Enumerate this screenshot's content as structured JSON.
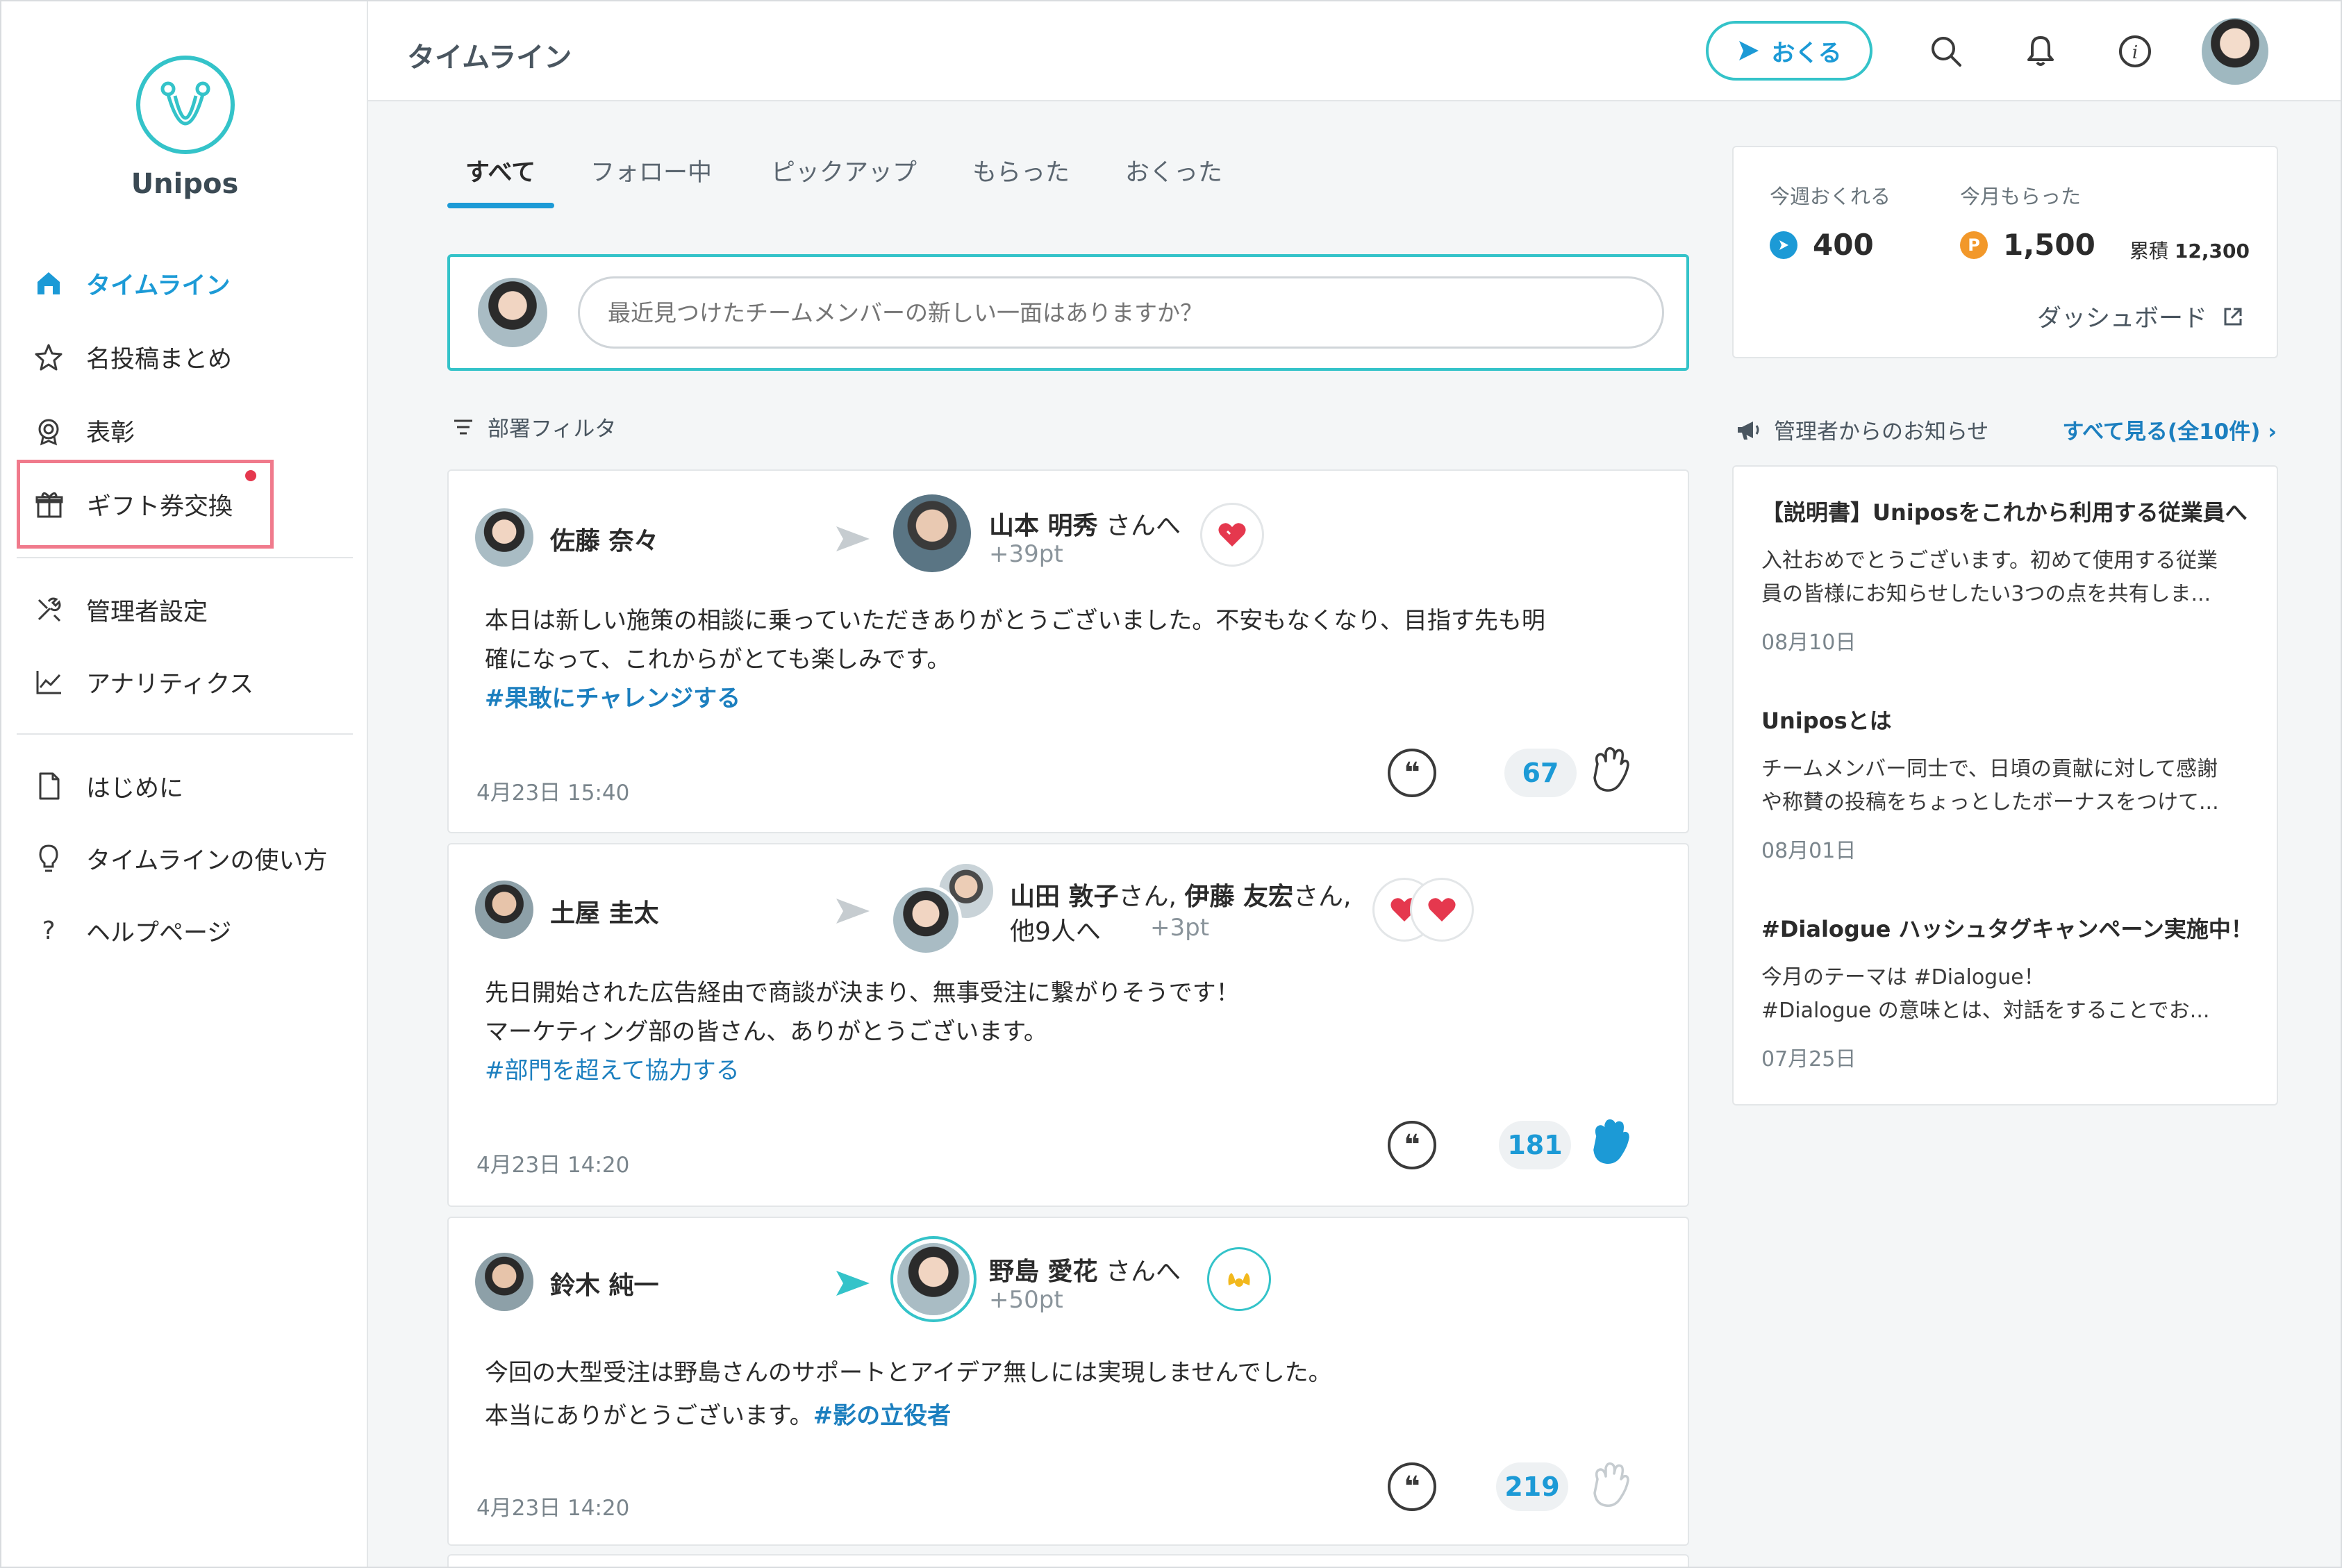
{
  "app": {
    "name": "Unipos",
    "header_title": "タイムライン",
    "accent": "#1c9ad6",
    "teal": "#34c3c9"
  },
  "sidebar": {
    "items": [
      {
        "label": "タイムライン",
        "icon": "home-icon",
        "active": true
      },
      {
        "label": "名投稿まとめ",
        "icon": "star-icon"
      },
      {
        "label": "表彰",
        "icon": "award-icon"
      },
      {
        "label": "ギフト券交換",
        "icon": "gift-icon",
        "has_dot": true
      },
      {
        "label": "管理者設定",
        "icon": "tools-icon"
      },
      {
        "label": "アナリティクス",
        "icon": "chart-icon"
      },
      {
        "label": "はじめに",
        "icon": "document-icon"
      },
      {
        "label": "タイムラインの使い方",
        "icon": "lightbulb-icon"
      },
      {
        "label": "ヘルプページ",
        "icon": "question-icon"
      }
    ]
  },
  "header": {
    "send_label": "おくる"
  },
  "tabs": [
    "すべて",
    "フォロー中",
    "ピックアップ",
    "もらった",
    "おくった"
  ],
  "composer": {
    "placeholder": "最近見つけたチームメンバーの新しい一面はありますか？"
  },
  "filter_label": "部署フィルタ",
  "posts": [
    {
      "sender": "佐藤 奈々",
      "recipient": "山本 明秀",
      "recipient_suffix": " さんへ",
      "points": "+39pt",
      "body_line1": "本日は新しい施策の相談に乗っていただきありがとうございました。不安もなくなり、目指す先も明",
      "body_line2": "確になって、これからがとても楽しみです。",
      "hashtag": "#果敢にチャレンジする",
      "date": "4月23日 15:40",
      "claps": "67"
    },
    {
      "sender": "土屋 圭太",
      "recipient_a": "山田 敦子",
      "recipient_sep": "さん, ",
      "recipient_b": "伊藤 友宏",
      "recipient_b_suffix": "さん,",
      "recipient_more": "他9人へ",
      "points": "+3pt",
      "body_line1": "先日開始された広告経由で商談が決まり、無事受注に繋がりそうです！",
      "body_line2": "マーケティング部の皆さん、ありがとうございます。",
      "hashtag": "#部門を超えて協力する",
      "date": "4月23日 14:20",
      "claps": "181"
    },
    {
      "sender": "鈴木 純一",
      "recipient": "野島 愛花",
      "recipient_suffix": " さんへ",
      "points": "+50pt",
      "body_line1": "今回の大型受注は野島さんのサポートとアイデア無しには実現しませんでした。",
      "body_line2": "本当にありがとうございます。",
      "hashtag": "#影の立役者",
      "date": "4月23日 14:20",
      "claps": "219"
    }
  ],
  "stats": {
    "week_label": "今週おくれる",
    "week_value": "400",
    "month_label": "今月もらった",
    "month_value": "1,500",
    "cumulative_label": "累積",
    "cumulative_value": "12,300",
    "dashboard_label": "ダッシュボード"
  },
  "notices": {
    "heading": "管理者からのお知らせ",
    "see_all": "すべて見る(全10件)",
    "items": [
      {
        "title": "【説明書】Uniposをこれから利用する従業員へ",
        "body1": "入社おめでとうございます。初めて使用する従業",
        "body2": "員の皆様にお知らせしたい3つの点を共有しま...",
        "date": "08月10日"
      },
      {
        "title": "Uniposとは",
        "body1": "チームメンバー同士で、日頃の貢献に対して感謝",
        "body2": "や称賛の投稿をちょっとしたボーナスをつけて...",
        "date": "08月01日"
      },
      {
        "title": "#Dialogue ハッシュタグキャンペーン実施中！",
        "body1": "今月のテーマは #Dialogue！",
        "body2": "#Dialogue の意味とは、対話をすることでお...",
        "date": "07月25日"
      }
    ]
  }
}
